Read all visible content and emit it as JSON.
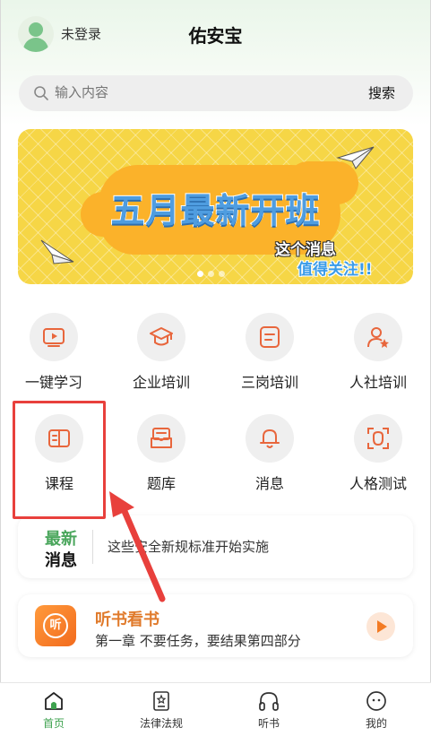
{
  "header": {
    "login_status": "未登录",
    "app_title": "佑安宝"
  },
  "search": {
    "placeholder": "输入内容",
    "button_label": "搜索"
  },
  "banner": {
    "headline": "五月最新开班",
    "sub_line1": "这个消息",
    "sub_line2": "值得关注!!",
    "page_count": 3,
    "active_page": 1
  },
  "features": [
    {
      "label": "一键学习",
      "icon": "play-video-icon"
    },
    {
      "label": "企业培训",
      "icon": "graduation-cap-icon"
    },
    {
      "label": "三岗培训",
      "icon": "document-list-icon"
    },
    {
      "label": "人社培训",
      "icon": "user-star-icon"
    },
    {
      "label": "课程",
      "icon": "book-icon"
    },
    {
      "label": "题库",
      "icon": "question-bank-icon"
    },
    {
      "label": "消息",
      "icon": "bell-icon"
    },
    {
      "label": "人格测试",
      "icon": "face-scan-icon"
    }
  ],
  "news": {
    "tag_line1": "最新",
    "tag_line2": "消息",
    "text": "这些安全新规标准开始实施"
  },
  "audiobook": {
    "icon_text": "听",
    "title": "听书看书",
    "subtitle": "第一章 不要任务，要结果第四部分"
  },
  "tabbar": {
    "items": [
      {
        "label": "首页",
        "icon": "home-icon",
        "active": true
      },
      {
        "label": "法律法规",
        "icon": "law-book-icon",
        "active": false
      },
      {
        "label": "听书",
        "icon": "headphones-icon",
        "active": false
      },
      {
        "label": "我的",
        "icon": "profile-face-icon",
        "active": false
      }
    ]
  },
  "colors": {
    "accent_green": "#3ea24f",
    "icon_orange": "#e8663c",
    "highlight_red": "#e8403c",
    "banner_yellow": "#f6d646"
  }
}
